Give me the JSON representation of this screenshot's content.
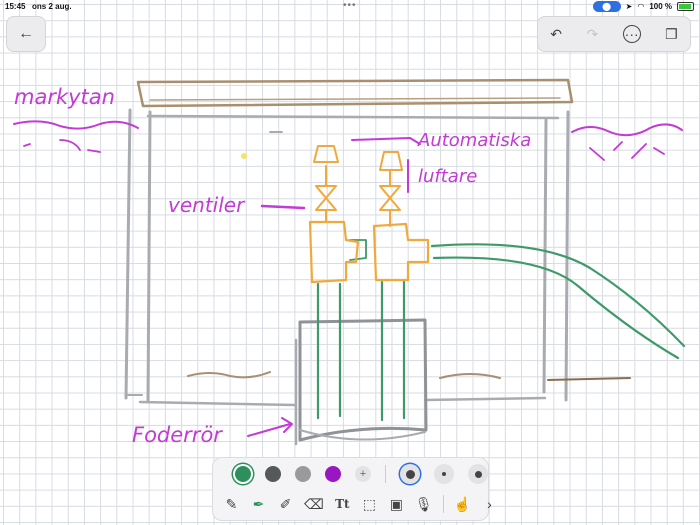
{
  "statusbar": {
    "time": "15:45",
    "date": "ons 2 aug.",
    "dots": "•••",
    "battery_text": "100 %"
  },
  "toolbar": {
    "back_glyph": "←",
    "undo_glyph": "↶",
    "redo_glyph": "↷",
    "more_glyph": "···",
    "pages_glyph": "❐"
  },
  "drawing": {
    "labels": {
      "markytan": "markytan",
      "automatiska": "Automatiska",
      "luftare": "luftare",
      "ventiler": "ventiler",
      "foderror": "Foderrör"
    },
    "colors": {
      "purple": "#c33ad6",
      "orange": "#f0a93c",
      "green": "#3f9a6a",
      "gray": "#a8abb0",
      "brown": "#a98f6f"
    }
  },
  "palette": {
    "colors": [
      "#2d8f5c",
      "#555a59",
      "#9a9a9a",
      "#9b16c3"
    ],
    "selected_color_index": 0,
    "add_glyph": "+",
    "tools": [
      "pencil-icon",
      "marker-icon",
      "highlighter-icon",
      "eraser-icon",
      "text-tool",
      "lasso-select",
      "image-icon",
      "microphone-icon",
      "touch-draw-icon"
    ],
    "text_tool_label": "Tt",
    "chevron": "›"
  }
}
